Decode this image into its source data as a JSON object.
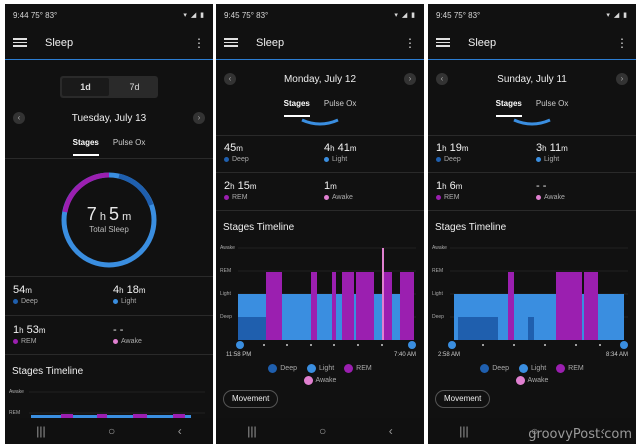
{
  "colors": {
    "deep": "#1f5fae",
    "light": "#3a8ee0",
    "rem": "#9b1fb0",
    "awake": "#e080d0",
    "accent": "#2c7dd2"
  },
  "status": {
    "time1": "9:44",
    "time2": "9:45",
    "time3": "9:45",
    "temps": "75° 83°",
    "signal": "VoLTE"
  },
  "app": {
    "title": "Sleep"
  },
  "p1": {
    "seg": [
      "1d",
      "7d"
    ],
    "date": "Tuesday, July 13",
    "tabs": [
      "Stages",
      "Pulse Ox"
    ],
    "total_h": "7",
    "total_m": "5",
    "total_label": "Total Sleep",
    "metrics": [
      {
        "h": "54",
        "hu": "m",
        "m": "",
        "mu": "",
        "label": "Deep"
      },
      {
        "h": "4",
        "hu": "h",
        "m": "18",
        "mu": "m",
        "label": "Light"
      },
      {
        "h": "1",
        "hu": "h",
        "m": "53",
        "mu": "m",
        "label": "REM"
      },
      {
        "h": "- -",
        "hu": "",
        "m": "",
        "mu": "",
        "label": "Awake"
      }
    ],
    "timeline_title": "Stages Timeline",
    "stage_labels": [
      "Awake",
      "REM"
    ]
  },
  "p2": {
    "date": "Monday, July 12",
    "tabs": [
      "Stages",
      "Pulse Ox"
    ],
    "metrics": [
      {
        "h": "45",
        "hu": "m",
        "m": "",
        "mu": "",
        "label": "Deep"
      },
      {
        "h": "4",
        "hu": "h",
        "m": "41",
        "mu": "m",
        "label": "Light"
      },
      {
        "h": "2",
        "hu": "h",
        "m": "15",
        "mu": "m",
        "label": "REM"
      },
      {
        "h": "1",
        "hu": "m",
        "m": "",
        "mu": "",
        "label": "Awake"
      }
    ],
    "timeline_title": "Stages Timeline",
    "stage_labels": [
      "Awake",
      "REM",
      "Light",
      "Deep"
    ],
    "start_time": "11:58 PM",
    "end_time": "7:40 AM",
    "legend": [
      "Deep",
      "Light",
      "REM",
      "Awake"
    ],
    "movement": "Movement"
  },
  "p3": {
    "date": "Sunday, July 11",
    "tabs": [
      "Stages",
      "Pulse Ox"
    ],
    "metrics": [
      {
        "h": "1",
        "hu": "h",
        "m": "19",
        "mu": "m",
        "label": "Deep"
      },
      {
        "h": "3",
        "hu": "h",
        "m": "11",
        "mu": "m",
        "label": "Light"
      },
      {
        "h": "1",
        "hu": "h",
        "m": "6",
        "mu": "m",
        "label": "REM"
      },
      {
        "h": "- -",
        "hu": "",
        "m": "",
        "mu": "",
        "label": "Awake"
      }
    ],
    "timeline_title": "Stages Timeline",
    "stage_labels": [
      "Awake",
      "REM",
      "Light",
      "Deep"
    ],
    "start_time": "2:58 AM",
    "end_time": "8:34 AM",
    "legend": [
      "Deep",
      "Light",
      "REM",
      "Awake"
    ],
    "movement": "Movement"
  },
  "watermark": "groovyPost.com"
}
